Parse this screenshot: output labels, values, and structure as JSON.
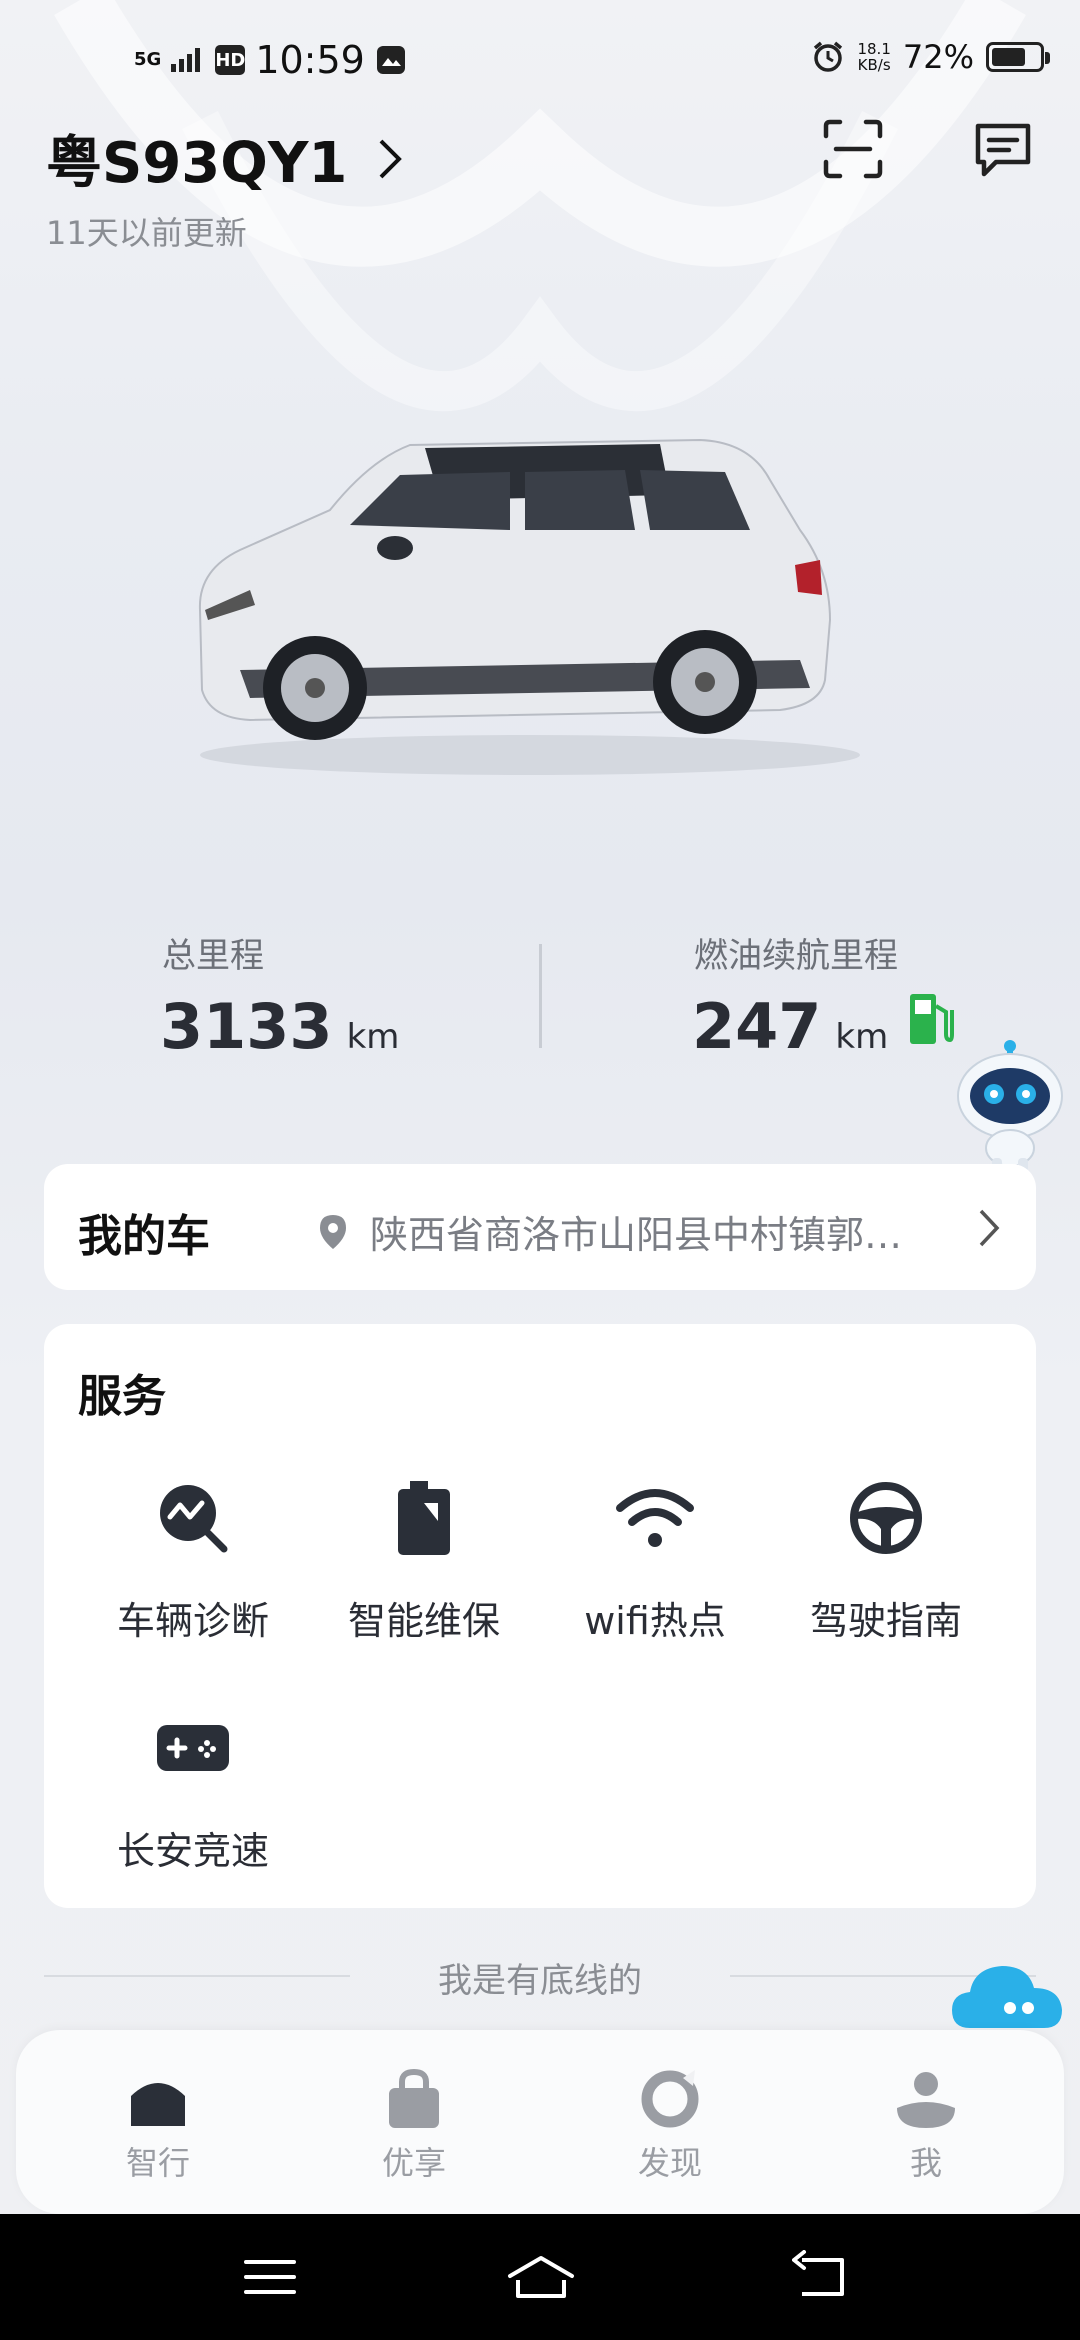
{
  "status_bar": {
    "network": "5G",
    "hd": "HD",
    "time": "10:59",
    "speed_value": "18.1",
    "speed_unit": "KB/s",
    "battery": "72%",
    "battery_level": 0.72
  },
  "header": {
    "plate": "粤S93QY1",
    "updated": "11天以前更新",
    "scan_icon": "scan-icon",
    "message_icon": "message-icon"
  },
  "stats": {
    "mileage_label": "总里程",
    "mileage_value": "3133",
    "mileage_unit": "km",
    "range_label": "燃油续航里程",
    "range_value": "247",
    "range_unit": "km",
    "fuel_icon": "fuel-pump-icon"
  },
  "my_car": {
    "title": "我的车",
    "location": "陕西省商洛市山阳县中村镇郭…"
  },
  "services": {
    "title": "服务",
    "items": [
      {
        "label": "车辆诊断",
        "icon": "diagnosis-icon"
      },
      {
        "label": "智能维保",
        "icon": "maintenance-icon"
      },
      {
        "label": "wifi热点",
        "icon": "wifi-icon"
      },
      {
        "label": "驾驶指南",
        "icon": "steering-wheel-icon"
      },
      {
        "label": "长安竞速",
        "icon": "gamepad-icon"
      }
    ]
  },
  "footer": {
    "baseline": "我是有底线的"
  },
  "tabs": [
    {
      "label": "智行",
      "icon": "home-icon"
    },
    {
      "label": "优享",
      "icon": "bag-icon"
    },
    {
      "label": "发现",
      "icon": "discover-icon"
    },
    {
      "label": "我",
      "icon": "person-icon"
    }
  ],
  "colors": {
    "accent_dark": "#2a2f38",
    "fuel_green": "#2bb24c",
    "assistant_blue": "#2ab0e8"
  }
}
